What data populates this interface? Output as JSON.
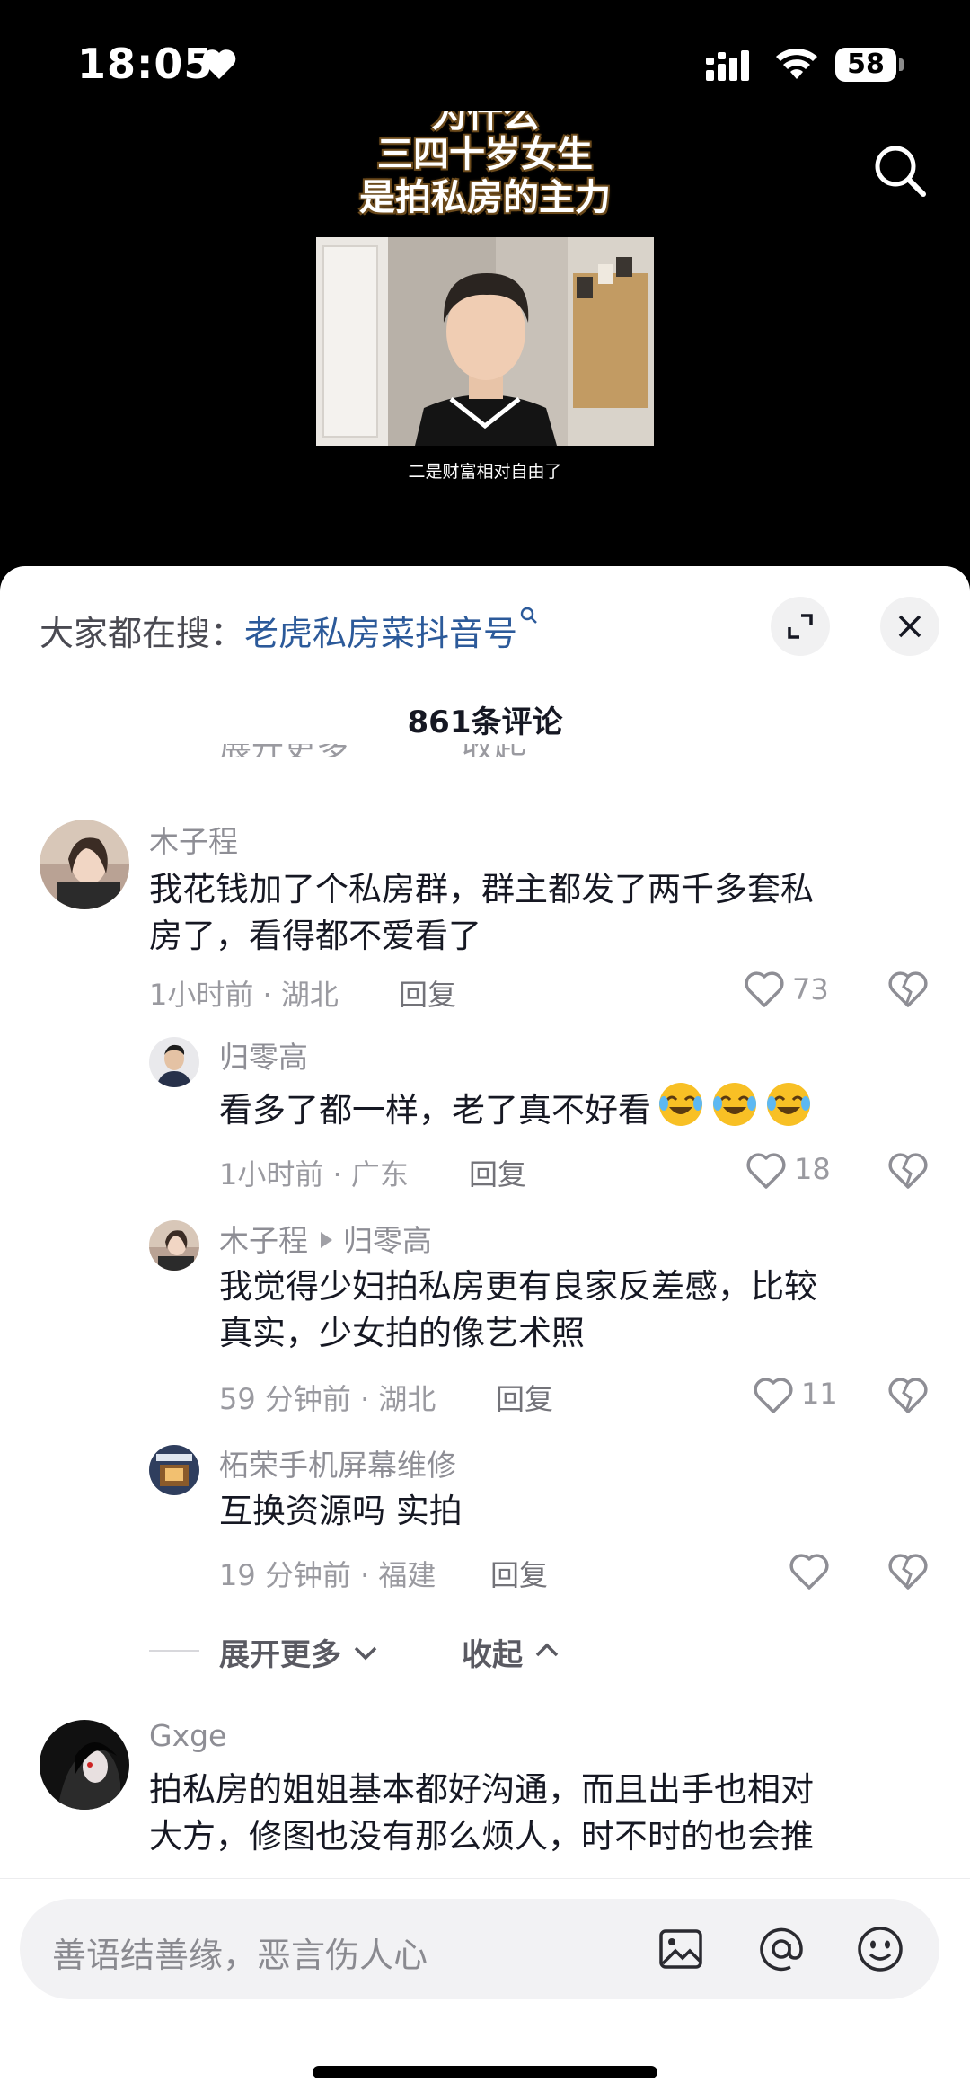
{
  "status_bar": {
    "time": "18:05",
    "battery": "58"
  },
  "video": {
    "title_line0": "为什么",
    "title_line1": "三四十岁女生",
    "title_line2": "是拍私房的主力",
    "subtitle": "二是财富相对自由了"
  },
  "sheet": {
    "hot_search_prefix": "大家都在搜：",
    "hot_search_keyword": "老虎私房菜抖音号",
    "comment_count": "861条评论",
    "ghost_left": "展开更多",
    "ghost_right": "收起"
  },
  "comments": [
    {
      "user": "木子程",
      "text_line1": "我花钱加了个私房群，群主都发了两千多套私",
      "text_line2": "房了，看得都不爱看了",
      "meta": "1小时前 · 湖北",
      "reply": "回复",
      "likes": "73"
    },
    {
      "user": "归零高",
      "text": "看多了都一样，老了真不好看",
      "meta": "1小时前 · 广东",
      "reply": "回复",
      "likes": "18"
    },
    {
      "user": "木子程",
      "reply_to": "归零高",
      "text_line1": "我觉得少妇拍私房更有良家反差感，比较",
      "text_line2": "真实，少女拍的像艺术照",
      "meta": "59 分钟前 · 湖北",
      "reply": "回复",
      "likes": "11"
    },
    {
      "user": "柘荣手机屏幕维修",
      "text": "互换资源吗 实拍",
      "meta": "19 分钟前 · 福建",
      "reply": "回复",
      "likes": ""
    },
    {
      "user": "Gxge",
      "text_line1": "拍私房的姐姐基本都好沟通，而且出手也相对",
      "text_line2": "大方，修图也没有那么烦人，时不时的也会推"
    }
  ],
  "more": {
    "expand": "展开更多",
    "collapse": "收起"
  },
  "input": {
    "placeholder": "善语结善缘，恶言伤人心"
  },
  "colors": {
    "link": "#2c5a9a",
    "text": "#161823",
    "meta": "#9a9aa0"
  }
}
